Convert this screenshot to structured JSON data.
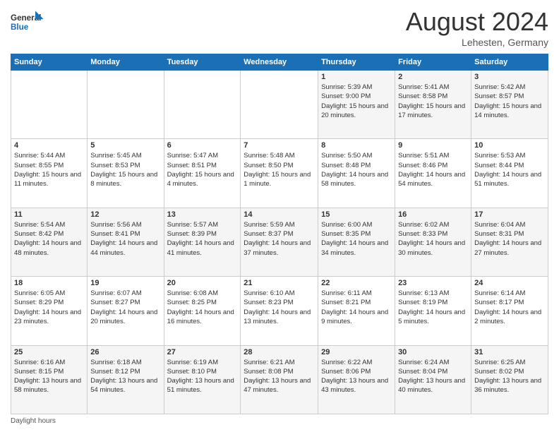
{
  "header": {
    "logo_line1": "General",
    "logo_line2": "Blue",
    "month": "August 2024",
    "location": "Lehesten, Germany"
  },
  "days_of_week": [
    "Sunday",
    "Monday",
    "Tuesday",
    "Wednesday",
    "Thursday",
    "Friday",
    "Saturday"
  ],
  "weeks": [
    [
      {
        "day": "",
        "info": ""
      },
      {
        "day": "",
        "info": ""
      },
      {
        "day": "",
        "info": ""
      },
      {
        "day": "",
        "info": ""
      },
      {
        "day": "1",
        "info": "Sunrise: 5:39 AM\nSunset: 9:00 PM\nDaylight: 15 hours and 20 minutes."
      },
      {
        "day": "2",
        "info": "Sunrise: 5:41 AM\nSunset: 8:58 PM\nDaylight: 15 hours and 17 minutes."
      },
      {
        "day": "3",
        "info": "Sunrise: 5:42 AM\nSunset: 8:57 PM\nDaylight: 15 hours and 14 minutes."
      }
    ],
    [
      {
        "day": "4",
        "info": "Sunrise: 5:44 AM\nSunset: 8:55 PM\nDaylight: 15 hours and 11 minutes."
      },
      {
        "day": "5",
        "info": "Sunrise: 5:45 AM\nSunset: 8:53 PM\nDaylight: 15 hours and 8 minutes."
      },
      {
        "day": "6",
        "info": "Sunrise: 5:47 AM\nSunset: 8:51 PM\nDaylight: 15 hours and 4 minutes."
      },
      {
        "day": "7",
        "info": "Sunrise: 5:48 AM\nSunset: 8:50 PM\nDaylight: 15 hours and 1 minute."
      },
      {
        "day": "8",
        "info": "Sunrise: 5:50 AM\nSunset: 8:48 PM\nDaylight: 14 hours and 58 minutes."
      },
      {
        "day": "9",
        "info": "Sunrise: 5:51 AM\nSunset: 8:46 PM\nDaylight: 14 hours and 54 minutes."
      },
      {
        "day": "10",
        "info": "Sunrise: 5:53 AM\nSunset: 8:44 PM\nDaylight: 14 hours and 51 minutes."
      }
    ],
    [
      {
        "day": "11",
        "info": "Sunrise: 5:54 AM\nSunset: 8:42 PM\nDaylight: 14 hours and 48 minutes."
      },
      {
        "day": "12",
        "info": "Sunrise: 5:56 AM\nSunset: 8:41 PM\nDaylight: 14 hours and 44 minutes."
      },
      {
        "day": "13",
        "info": "Sunrise: 5:57 AM\nSunset: 8:39 PM\nDaylight: 14 hours and 41 minutes."
      },
      {
        "day": "14",
        "info": "Sunrise: 5:59 AM\nSunset: 8:37 PM\nDaylight: 14 hours and 37 minutes."
      },
      {
        "day": "15",
        "info": "Sunrise: 6:00 AM\nSunset: 8:35 PM\nDaylight: 14 hours and 34 minutes."
      },
      {
        "day": "16",
        "info": "Sunrise: 6:02 AM\nSunset: 8:33 PM\nDaylight: 14 hours and 30 minutes."
      },
      {
        "day": "17",
        "info": "Sunrise: 6:04 AM\nSunset: 8:31 PM\nDaylight: 14 hours and 27 minutes."
      }
    ],
    [
      {
        "day": "18",
        "info": "Sunrise: 6:05 AM\nSunset: 8:29 PM\nDaylight: 14 hours and 23 minutes."
      },
      {
        "day": "19",
        "info": "Sunrise: 6:07 AM\nSunset: 8:27 PM\nDaylight: 14 hours and 20 minutes."
      },
      {
        "day": "20",
        "info": "Sunrise: 6:08 AM\nSunset: 8:25 PM\nDaylight: 14 hours and 16 minutes."
      },
      {
        "day": "21",
        "info": "Sunrise: 6:10 AM\nSunset: 8:23 PM\nDaylight: 14 hours and 13 minutes."
      },
      {
        "day": "22",
        "info": "Sunrise: 6:11 AM\nSunset: 8:21 PM\nDaylight: 14 hours and 9 minutes."
      },
      {
        "day": "23",
        "info": "Sunrise: 6:13 AM\nSunset: 8:19 PM\nDaylight: 14 hours and 5 minutes."
      },
      {
        "day": "24",
        "info": "Sunrise: 6:14 AM\nSunset: 8:17 PM\nDaylight: 14 hours and 2 minutes."
      }
    ],
    [
      {
        "day": "25",
        "info": "Sunrise: 6:16 AM\nSunset: 8:15 PM\nDaylight: 13 hours and 58 minutes."
      },
      {
        "day": "26",
        "info": "Sunrise: 6:18 AM\nSunset: 8:12 PM\nDaylight: 13 hours and 54 minutes."
      },
      {
        "day": "27",
        "info": "Sunrise: 6:19 AM\nSunset: 8:10 PM\nDaylight: 13 hours and 51 minutes."
      },
      {
        "day": "28",
        "info": "Sunrise: 6:21 AM\nSunset: 8:08 PM\nDaylight: 13 hours and 47 minutes."
      },
      {
        "day": "29",
        "info": "Sunrise: 6:22 AM\nSunset: 8:06 PM\nDaylight: 13 hours and 43 minutes."
      },
      {
        "day": "30",
        "info": "Sunrise: 6:24 AM\nSunset: 8:04 PM\nDaylight: 13 hours and 40 minutes."
      },
      {
        "day": "31",
        "info": "Sunrise: 6:25 AM\nSunset: 8:02 PM\nDaylight: 13 hours and 36 minutes."
      }
    ]
  ],
  "footer": {
    "note": "Daylight hours"
  }
}
